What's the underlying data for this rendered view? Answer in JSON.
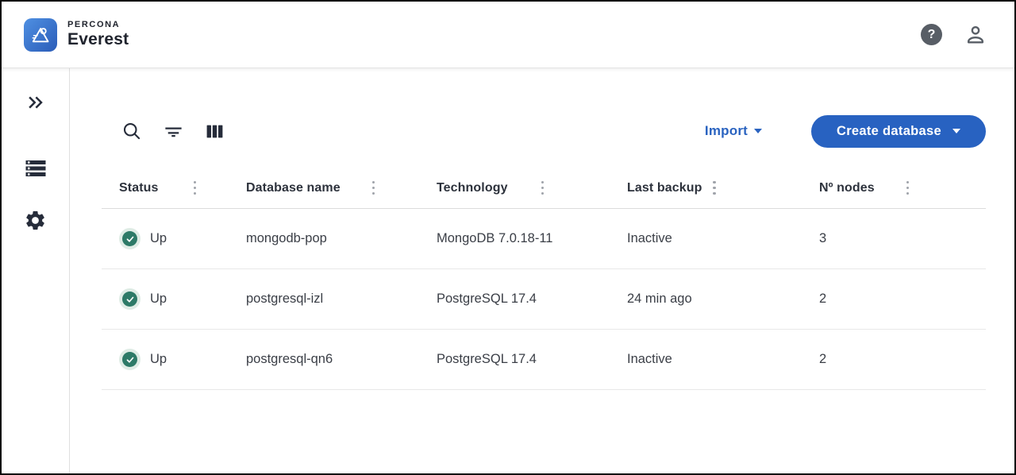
{
  "header": {
    "brand_top": "PERCONA",
    "brand_bottom": "Everest",
    "help_glyph": "?"
  },
  "toolbar": {
    "import_label": "Import",
    "create_database_label": "Create database"
  },
  "table": {
    "columns": [
      {
        "label": "Status"
      },
      {
        "label": "Database name"
      },
      {
        "label": "Technology"
      },
      {
        "label": "Last backup"
      },
      {
        "label": "Nº nodes"
      }
    ],
    "rows": [
      {
        "status": "Up",
        "name": "mongodb-pop",
        "technology": "MongoDB 7.0.18-11",
        "last_backup": "Inactive",
        "nodes": "3"
      },
      {
        "status": "Up",
        "name": "postgresql-izl",
        "technology": "PostgreSQL 17.4",
        "last_backup": "24 min ago",
        "nodes": "2"
      },
      {
        "status": "Up",
        "name": "postgresql-qn6",
        "technology": "PostgreSQL 17.4",
        "last_backup": "Inactive",
        "nodes": "2"
      }
    ]
  },
  "icons": {
    "logo": "mountain-peak",
    "help": "question-mark-circle",
    "account": "person-outline",
    "sidebar_collapse": "double-chevron-right",
    "sidebar_databases": "stacked-storage",
    "sidebar_settings": "gear",
    "search": "magnifier",
    "filter": "filter-lines",
    "columns": "vertical-bars",
    "column_menu": "vertical-three-dots",
    "status_up": "check-circle-green",
    "dropdown": "caret-down"
  },
  "colors": {
    "accent_blue": "#2862c1",
    "import_blue": "#2a63c0",
    "status_green": "#2d7a67",
    "status_green_ring": "#dfece5",
    "icon_dark": "#262c3a",
    "icon_gray": "#585e66"
  }
}
